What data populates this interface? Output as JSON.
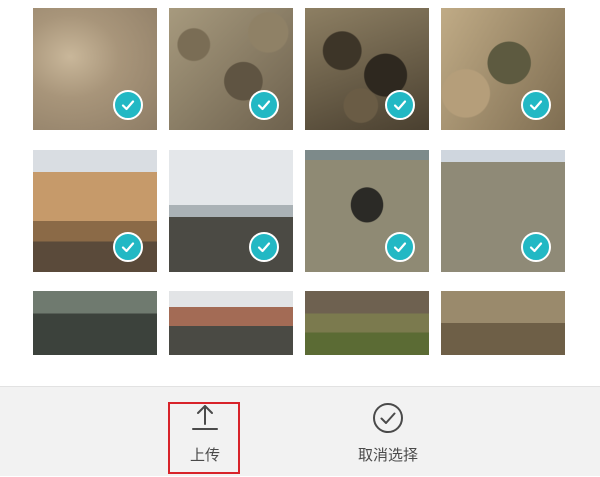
{
  "gallery": {
    "photos": [
      {
        "label": "photo-1",
        "selected": true
      },
      {
        "label": "photo-2",
        "selected": true
      },
      {
        "label": "photo-3",
        "selected": true
      },
      {
        "label": "photo-4",
        "selected": true
      },
      {
        "label": "photo-5",
        "selected": true
      },
      {
        "label": "photo-6",
        "selected": true
      },
      {
        "label": "photo-7",
        "selected": true
      },
      {
        "label": "photo-8",
        "selected": true
      },
      {
        "label": "photo-9",
        "selected": false
      },
      {
        "label": "photo-10",
        "selected": false
      },
      {
        "label": "photo-11",
        "selected": false
      },
      {
        "label": "photo-12",
        "selected": false
      }
    ],
    "check_icon": "checkmark-icon",
    "accent_color": "#22b8c4"
  },
  "actions": {
    "upload": {
      "label": "上传",
      "icon": "upload-icon"
    },
    "cancel_selection": {
      "label": "取消选择",
      "icon": "check-circle-icon"
    }
  },
  "highlight_color": "#d8232a"
}
